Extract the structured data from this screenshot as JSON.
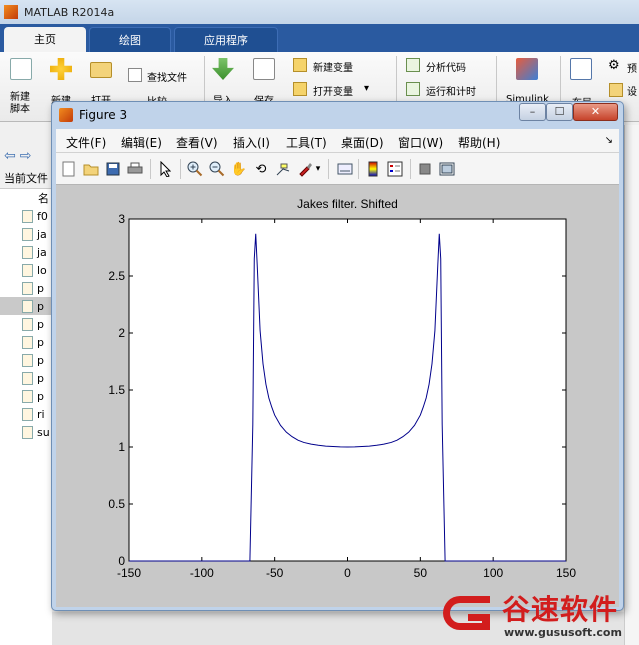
{
  "app": {
    "title": "MATLAB R2014a"
  },
  "tabs": [
    {
      "label": "主页",
      "active": true
    },
    {
      "label": "绘图",
      "active": false
    },
    {
      "label": "应用程序",
      "active": false
    }
  ],
  "ribbon": {
    "new_script": "新建\n脚本",
    "new": "新建",
    "open": "打开",
    "find_files": "查找文件",
    "compare": "比较",
    "import": "导入",
    "save": "保存",
    "new_variable": "新建变量",
    "open_variable": "打开变量",
    "analyze_code": "分析代码",
    "run_time": "运行和计时",
    "simulink": "Simulink",
    "layout": "布局",
    "preferences": "预",
    "set_path": "设"
  },
  "current_folder": {
    "label": "当前文件",
    "header": "名"
  },
  "files": [
    "f0",
    "ja",
    "ja",
    "lo",
    "p",
    "p",
    "p",
    "p",
    "p",
    "p",
    "p",
    "ri",
    "su"
  ],
  "figure": {
    "title": "Figure 3",
    "menus": [
      "文件(F)",
      "编辑(E)",
      "查看(V)",
      "插入(I)",
      "工具(T)",
      "桌面(D)",
      "窗口(W)",
      "帮助(H)"
    ],
    "plot_title": "Jakes filter. Shifted"
  },
  "chart_data": {
    "type": "line",
    "title": "Jakes filter. Shifted",
    "xlabel": "",
    "ylabel": "",
    "xlim": [
      -150,
      150
    ],
    "ylim": [
      0,
      3
    ],
    "xticks": [
      -150,
      -100,
      -50,
      0,
      50,
      100,
      150
    ],
    "yticks": [
      0,
      0.5,
      1,
      1.5,
      2,
      2.5,
      3
    ],
    "grid": false,
    "series": [
      {
        "color": "#00008b",
        "x": [
          -150,
          -67,
          -65,
          -64,
          -63,
          -62,
          -60,
          -58,
          -56,
          -54,
          -52,
          -50,
          -46,
          -42,
          -38,
          -34,
          -30,
          -25,
          -20,
          -15,
          -10,
          -5,
          0,
          5,
          10,
          15,
          20,
          25,
          30,
          34,
          38,
          42,
          46,
          50,
          52,
          54,
          56,
          58,
          60,
          62,
          63,
          64,
          65,
          67,
          150
        ],
        "y": [
          0,
          0,
          1.2,
          2.65,
          2.87,
          2.6,
          2.02,
          1.73,
          1.55,
          1.43,
          1.35,
          1.28,
          1.19,
          1.13,
          1.09,
          1.06,
          1.04,
          1.025,
          1.015,
          1.008,
          1.004,
          1.001,
          1.0,
          1.001,
          1.004,
          1.008,
          1.015,
          1.025,
          1.04,
          1.06,
          1.09,
          1.13,
          1.19,
          1.28,
          1.35,
          1.43,
          1.55,
          1.73,
          2.02,
          2.6,
          2.87,
          2.65,
          1.2,
          0,
          0
        ]
      }
    ]
  },
  "watermark": {
    "brand": "谷速软件",
    "url": "www.gususoft.com"
  },
  "colors": {
    "tab_blue": "#2a5aa0",
    "plot_line": "#00008b",
    "watermark_red": "#d21d1d"
  }
}
